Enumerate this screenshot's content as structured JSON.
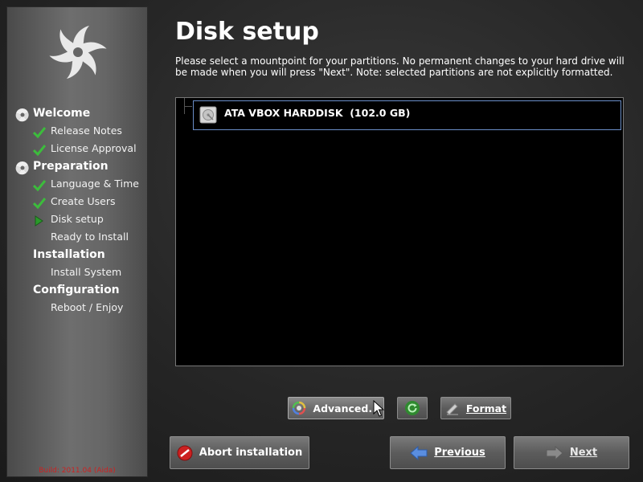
{
  "sidebar": {
    "sections": [
      {
        "label": "Welcome",
        "items": [
          {
            "label": "Release Notes",
            "status": "done"
          },
          {
            "label": "License Approval",
            "status": "done"
          }
        ]
      },
      {
        "label": "Preparation",
        "items": [
          {
            "label": "Language & Time",
            "status": "done"
          },
          {
            "label": "Create Users",
            "status": "done"
          },
          {
            "label": "Disk setup",
            "status": "current"
          },
          {
            "label": "Ready to Install",
            "status": "pending"
          }
        ]
      },
      {
        "label": "Installation",
        "items": [
          {
            "label": "Install System",
            "status": "pending"
          }
        ]
      },
      {
        "label": "Configuration",
        "items": [
          {
            "label": "Reboot / Enjoy",
            "status": "pending"
          }
        ]
      }
    ],
    "build": "Build: 2011.04 (Aida)"
  },
  "main": {
    "title": "Disk setup",
    "description": "Please select a mountpoint for your partitions. No permanent changes to your hard drive will be made when you will press \"Next\". Note: selected partitions are not explicitly formatted.",
    "disks": [
      {
        "name": "ATA VBOX HARDDISK  (102.0 GB)",
        "icon": "harddisk-icon",
        "selected": true
      }
    ]
  },
  "buttons": {
    "advanced": "Advanced...",
    "refresh_icon": "refresh-icon",
    "format": "Format",
    "abort": "Abort installation",
    "previous": "Previous",
    "next": "Next"
  },
  "colors": {
    "check_green": "#3cbc3c",
    "selection_border": "#6a8ec8",
    "build_text": "#cc2222"
  }
}
